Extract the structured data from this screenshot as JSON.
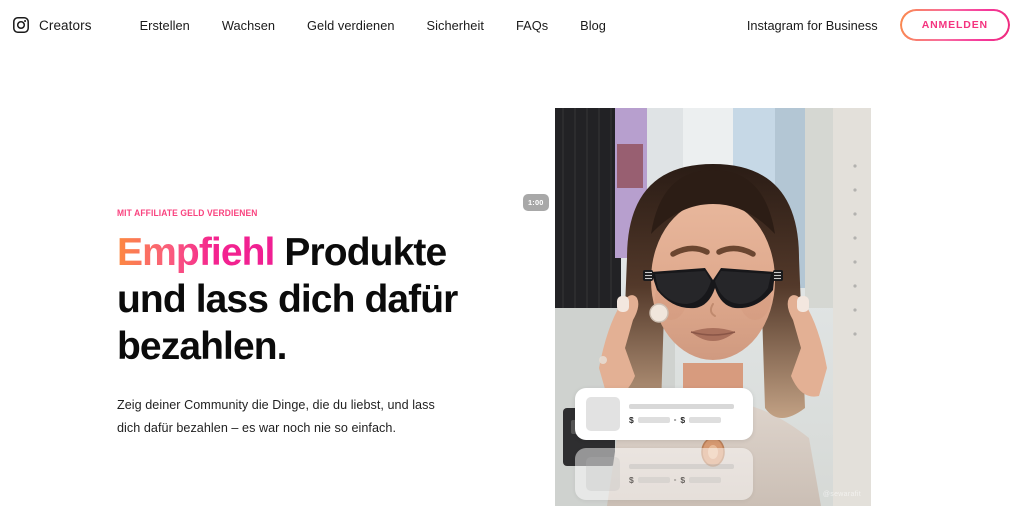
{
  "header": {
    "brand": {
      "icon": "instagram-camera-icon",
      "label": "Creators"
    },
    "nav": [
      {
        "label": "Erstellen"
      },
      {
        "label": "Wachsen"
      },
      {
        "label": "Geld verdienen"
      },
      {
        "label": "Sicherheit"
      },
      {
        "label": "FAQs"
      },
      {
        "label": "Blog"
      }
    ],
    "business_link": "Instagram for Business",
    "cta": {
      "label": "ANMELDEN",
      "text_color": "#f4337f"
    }
  },
  "hero": {
    "eyebrow": "MIT AFFILIATE GELD VERDIENEN",
    "eyebrow_color": "#f9437f",
    "headline_gradient_word": "Empfiehl",
    "headline_rest": " Produkte und lass dich dafür bezahlen.",
    "subcopy": "Zeig deiner Community die Dinge, die du liebst, und lass dich dafür bezahlen – es war noch nie so einfach.",
    "gradient_from": "#fc8a3f",
    "gradient_to": "#ef1f93"
  },
  "media": {
    "alt": "Frau mit schwarzer Sonnenbrille vor einer Kleiderstange",
    "time_badge": "1:00",
    "watermark": "@sewarafit",
    "product_cards": [
      {
        "price_prefix": "$",
        "price_separator": "-",
        "price_prefix_2": "$"
      },
      {
        "price_prefix": "$",
        "price_separator": "-",
        "price_prefix_2": "$"
      }
    ]
  }
}
